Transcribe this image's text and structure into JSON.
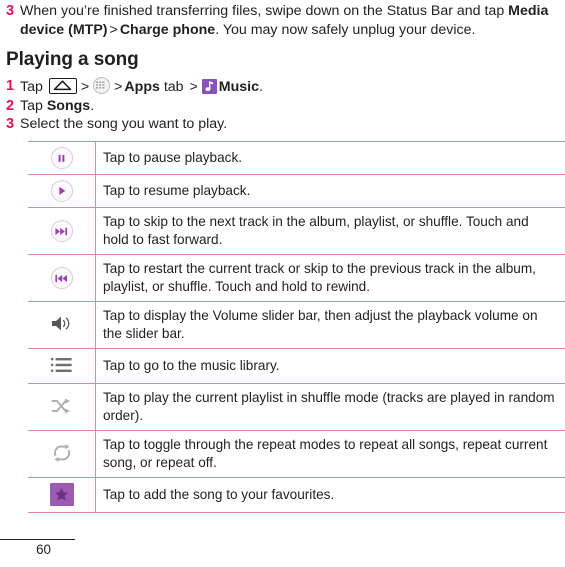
{
  "document": {
    "page_number": "60"
  },
  "intro_step": {
    "number": "3",
    "text_part1": "When you’re finished transferring files, swipe down on the Status Bar and tap ",
    "bold1": "Media device (MTP)",
    "sep": ">",
    "bold2": "Charge phone",
    "text_part2": ". You may now safely unplug your device."
  },
  "section": {
    "heading": "Playing a song",
    "steps": [
      {
        "number": "1",
        "prefix": "Tap ",
        "home_icon": "home-key-icon",
        "sep1": ">",
        "apps_icon": "apps-grid-icon",
        "sep2": ">",
        "bold_apps": "Apps",
        "mid": " tab ",
        "sep3": ">",
        "music_icon": "music-app-icon",
        "bold_music": "Music",
        "suffix": "."
      },
      {
        "number": "2",
        "prefix": "Tap ",
        "bold": "Songs",
        "suffix": "."
      },
      {
        "number": "3",
        "text": "Select the song you want to play."
      }
    ]
  },
  "controls_table": {
    "rows": [
      {
        "icon": "pause-icon",
        "description": "Tap to pause playback."
      },
      {
        "icon": "play-icon",
        "description": "Tap to resume playback."
      },
      {
        "icon": "next-track-icon",
        "description": "Tap to skip to the next track in the album, playlist, or shuffle. Touch and hold to fast forward."
      },
      {
        "icon": "previous-track-icon",
        "description": "Tap to restart the current track or skip to the previous track in the album, playlist, or shuffle. Touch and hold to rewind."
      },
      {
        "icon": "volume-icon",
        "description": "Tap to display the Volume slider bar, then adjust the playback volume on the slider bar."
      },
      {
        "icon": "library-list-icon",
        "description": "Tap to go to the music library."
      },
      {
        "icon": "shuffle-icon",
        "description": "Tap to play the current playlist in shuffle mode (tracks are played in random order)."
      },
      {
        "icon": "repeat-icon",
        "description": "Tap to toggle through the repeat modes to repeat all songs, repeat current song, or repeat off."
      },
      {
        "icon": "favourite-star-icon",
        "description": "Tap to add the song to your favourites."
      }
    ]
  },
  "colors": {
    "accent_pink": "#e0115f",
    "rule_pink": "#e2849f",
    "purple_glyph": "#9b3fb3",
    "purple_tile": "#8753b8",
    "star_tile": "#9a5cb0",
    "gray_glyph": "#9e9e9e",
    "dark_glyph": "#58585b"
  }
}
